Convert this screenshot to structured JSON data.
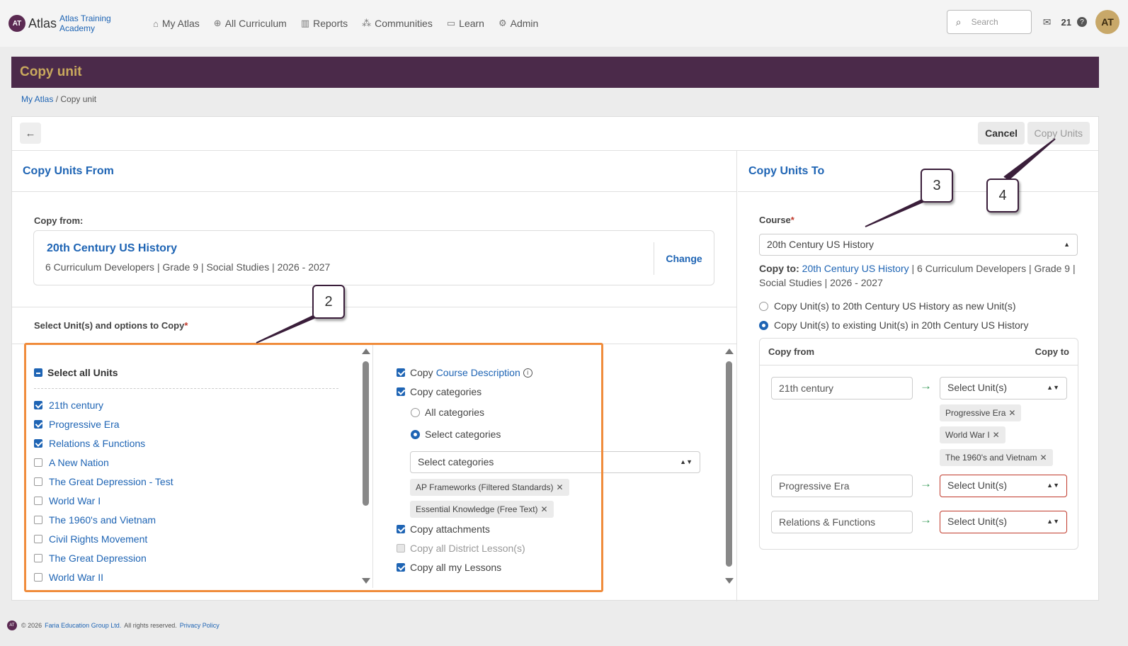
{
  "app": {
    "logo_mark": "AT",
    "logo_name": "Atlas",
    "org_name": "Atlas Training Academy"
  },
  "nav": {
    "items": [
      {
        "label": "My Atlas",
        "icon": "home-icon",
        "glyph": "⌂"
      },
      {
        "label": "All Curriculum",
        "icon": "globe-icon",
        "glyph": "⊕"
      },
      {
        "label": "Reports",
        "icon": "bar-chart-icon",
        "glyph": "▥"
      },
      {
        "label": "Communities",
        "icon": "network-icon",
        "glyph": "⁂"
      },
      {
        "label": "Learn",
        "icon": "book-icon",
        "glyph": "▭"
      },
      {
        "label": "Admin",
        "icon": "gear-icon",
        "glyph": "⚙"
      }
    ],
    "search_placeholder": "Search",
    "notification_count": "21",
    "avatar_initials": "AT"
  },
  "page": {
    "title": "Copy unit",
    "breadcrumb_home": "My Atlas",
    "breadcrumb_current": "Copy unit",
    "cancel_label": "Cancel",
    "copy_units_label": "Copy Units"
  },
  "from": {
    "heading": "Copy Units From",
    "copy_from_label": "Copy from:",
    "course_title": "20th Century US History",
    "course_meta": "6 Curriculum Developers | Grade 9 | Social Studies | 2026 - 2027",
    "change_label": "Change",
    "select_label": "Select Unit(s) and options to Copy",
    "select_all_label": "Select all Units",
    "units": [
      {
        "label": "21th century",
        "checked": true
      },
      {
        "label": "Progressive Era",
        "checked": true
      },
      {
        "label": "Relations & Functions",
        "checked": true
      },
      {
        "label": "A New Nation",
        "checked": false
      },
      {
        "label": "The Great Depression - Test",
        "checked": false
      },
      {
        "label": "World War I",
        "checked": false
      },
      {
        "label": "The 1960's and Vietnam",
        "checked": false
      },
      {
        "label": "Civil Rights Movement",
        "checked": false
      },
      {
        "label": "The Great Depression",
        "checked": false
      },
      {
        "label": "World War II",
        "checked": false
      }
    ],
    "options": {
      "copy_prefix": "Copy",
      "course_description_link": "Course Description",
      "copy_categories": "Copy categories",
      "all_categories": "All categories",
      "select_categories": "Select categories",
      "select_categories_placeholder": "Select categories",
      "tags": [
        "AP Frameworks (Filtered Standards)",
        "Essential Knowledge (Free Text)"
      ],
      "copy_attachments": "Copy attachments",
      "copy_district_lessons": "Copy all District Lesson(s)",
      "copy_my_lessons": "Copy all my Lessons"
    }
  },
  "to": {
    "heading": "Copy Units To",
    "course_label": "Course",
    "course_value": "20th Century US History",
    "copy_to_label": "Copy to:",
    "copy_to_link": "20th Century US History",
    "copy_to_meta": "| 6 Curriculum Developers | Grade 9 | Social Studies | 2026 - 2027",
    "radio_new": "Copy Unit(s) to 20th Century US History as new Unit(s)",
    "radio_existing": "Copy Unit(s) to existing Unit(s) in 20th Century US History",
    "map_from_header": "Copy from",
    "map_to_header": "Copy to",
    "mappings": [
      {
        "from": "21th century",
        "to": "Select Unit(s)",
        "tags": [
          "Progressive Era",
          "World War I",
          "The 1960's and Vietnam"
        ]
      },
      {
        "from": "Progressive Era",
        "to": "Select Unit(s)",
        "tags": []
      },
      {
        "from": "Relations & Functions",
        "to": "Select Unit(s)",
        "tags": []
      }
    ]
  },
  "callouts": [
    "2",
    "3",
    "4"
  ],
  "footer": {
    "copyright": "© 2026",
    "company_link": "Faria Education Group Ltd.",
    "rights": "All rights reserved.",
    "privacy_link": "Privacy Policy"
  },
  "colors": {
    "brand_purple": "#4b2a4a",
    "brand_gold": "#c9a95d",
    "link_blue": "#1e64b4",
    "highlight_orange": "#f08c3c",
    "error_red": "#c0392b"
  }
}
